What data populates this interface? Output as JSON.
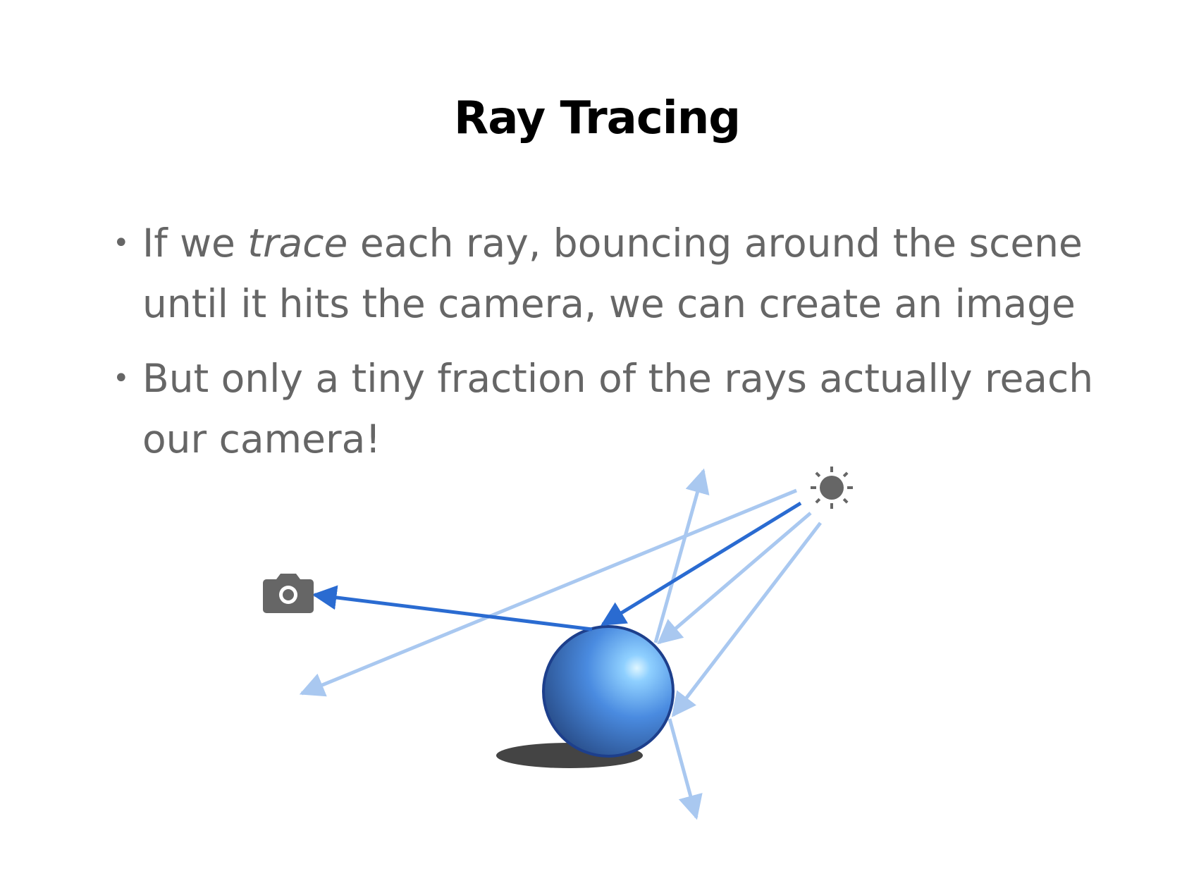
{
  "slide": {
    "title": "Ray Tracing",
    "bullets": [
      {
        "before": "If we ",
        "emphasis": "trace",
        "after": " each ray, bouncing around the scene until it hits the camera, we can create an image"
      },
      {
        "text": "But only a tiny fraction of the rays actually reach our camera!"
      }
    ]
  },
  "diagram": {
    "icons": [
      "camera-icon",
      "sun-icon"
    ],
    "colors": {
      "ray_primary": "#2a6bd1",
      "ray_secondary": "#a9c8f0",
      "sphere": "#4a8be0",
      "sphere_outline": "#1d3f8c",
      "shadow": "#444444",
      "icon": "#666666"
    }
  }
}
